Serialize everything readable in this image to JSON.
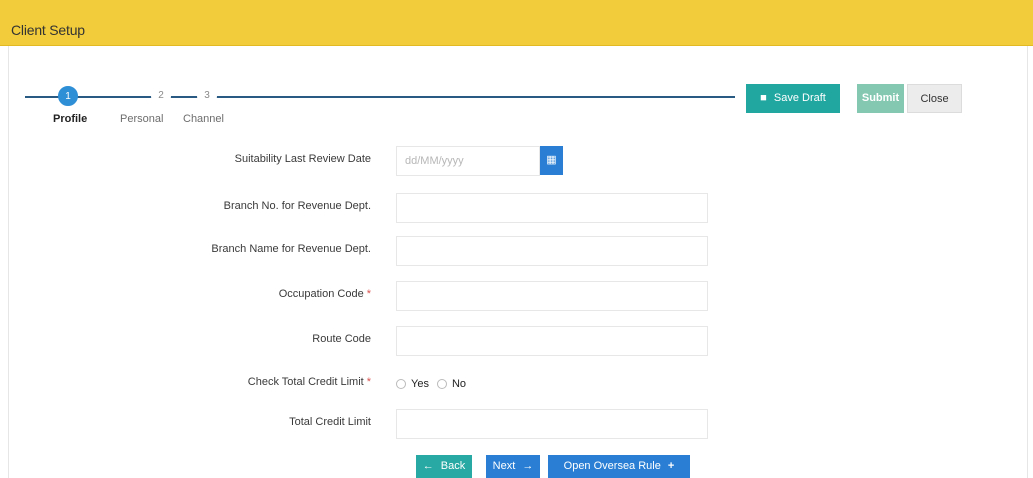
{
  "header": {
    "title": "Client Setup"
  },
  "steps": [
    {
      "number": "1",
      "label": "Profile",
      "active": true
    },
    {
      "number": "2",
      "label": "Personal",
      "active": false
    },
    {
      "number": "3",
      "label": "Channel",
      "active": false
    }
  ],
  "toolbar": {
    "save_draft_label": "Save Draft",
    "submit_label": "Submit",
    "close_label": "Close"
  },
  "form": {
    "suitability_last_review_date": {
      "label": "Suitability Last Review Date",
      "value": "",
      "placeholder": "dd/MM/yyyy"
    },
    "branch_no": {
      "label": "Branch No. for Revenue Dept.",
      "value": ""
    },
    "branch_name": {
      "label": "Branch Name for Revenue Dept.",
      "value": ""
    },
    "occupation_code": {
      "label": "Occupation Code",
      "required_mark": "*",
      "value": ""
    },
    "route_code": {
      "label": "Route Code",
      "value": ""
    },
    "check_total_credit_limit": {
      "label": "Check Total Credit Limit",
      "required_mark": "*",
      "options": [
        "Yes",
        "No"
      ],
      "selected": ""
    },
    "total_credit_limit": {
      "label": "Total Credit Limit",
      "value": ""
    }
  },
  "actions": {
    "back_label": "Back",
    "next_label": "Next",
    "open_oversea_rule_label": "Open Oversea Rule"
  },
  "icons": {
    "save": "save-icon",
    "calendar": "calendar-icon",
    "back": "arrow-left-icon",
    "next": "arrow-right-icon",
    "plus": "plus-icon"
  },
  "colors": {
    "header_bg": "#f2cc3a",
    "primary": "#2a7fd4",
    "teal": "#21a6a0",
    "submit": "#84c8b2"
  }
}
